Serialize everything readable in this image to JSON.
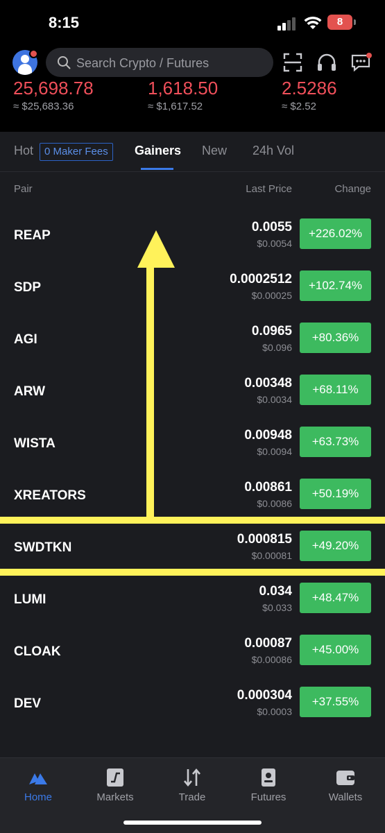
{
  "status_bar": {
    "time": "8:15",
    "battery": "8"
  },
  "search": {
    "placeholder": "Search Crypto / Futures"
  },
  "header_icons": [
    "scan-icon",
    "headset-icon",
    "chat-icon"
  ],
  "tickers": [
    {
      "value": "25,698.78",
      "fiat": "≈ $25,683.36"
    },
    {
      "value": "1,618.50",
      "fiat": "≈ $1,617.52"
    },
    {
      "value": "2.5286",
      "fiat": "≈ $2.52"
    }
  ],
  "tabs": {
    "hot": "Hot",
    "maker_fees": "0 Maker Fees",
    "gainers": "Gainers",
    "new": "New",
    "vol": "24h Vol"
  },
  "columns": {
    "pair": "Pair",
    "last_price": "Last Price",
    "change": "Change"
  },
  "rows": [
    {
      "pair": "REAP",
      "price": "0.0055",
      "usd": "$0.0054",
      "change": "+226.02%"
    },
    {
      "pair": "SDP",
      "price": "0.0002512",
      "usd": "$0.00025",
      "change": "+102.74%"
    },
    {
      "pair": "AGI",
      "price": "0.0965",
      "usd": "$0.096",
      "change": "+80.36%"
    },
    {
      "pair": "ARW",
      "price": "0.00348",
      "usd": "$0.0034",
      "change": "+68.11%"
    },
    {
      "pair": "WISTA",
      "price": "0.00948",
      "usd": "$0.0094",
      "change": "+63.73%"
    },
    {
      "pair": "XREATORS",
      "price": "0.00861",
      "usd": "$0.0086",
      "change": "+50.19%"
    },
    {
      "pair": "SWDTKN",
      "price": "0.000815",
      "usd": "$0.00081",
      "change": "+49.20%"
    },
    {
      "pair": "LUMI",
      "price": "0.034",
      "usd": "$0.033",
      "change": "+48.47%"
    },
    {
      "pair": "CLOAK",
      "price": "0.00087",
      "usd": "$0.00086",
      "change": "+45.00%"
    },
    {
      "pair": "DEV",
      "price": "0.000304",
      "usd": "$0.0003",
      "change": "+37.55%"
    }
  ],
  "nav": {
    "home": "Home",
    "markets": "Markets",
    "trade": "Trade",
    "futures": "Futures",
    "wallets": "Wallets"
  },
  "colors": {
    "down": "#ef4f5a",
    "up": "#3dba5f",
    "accent": "#3b7ae8",
    "highlight": "#fff25a"
  }
}
